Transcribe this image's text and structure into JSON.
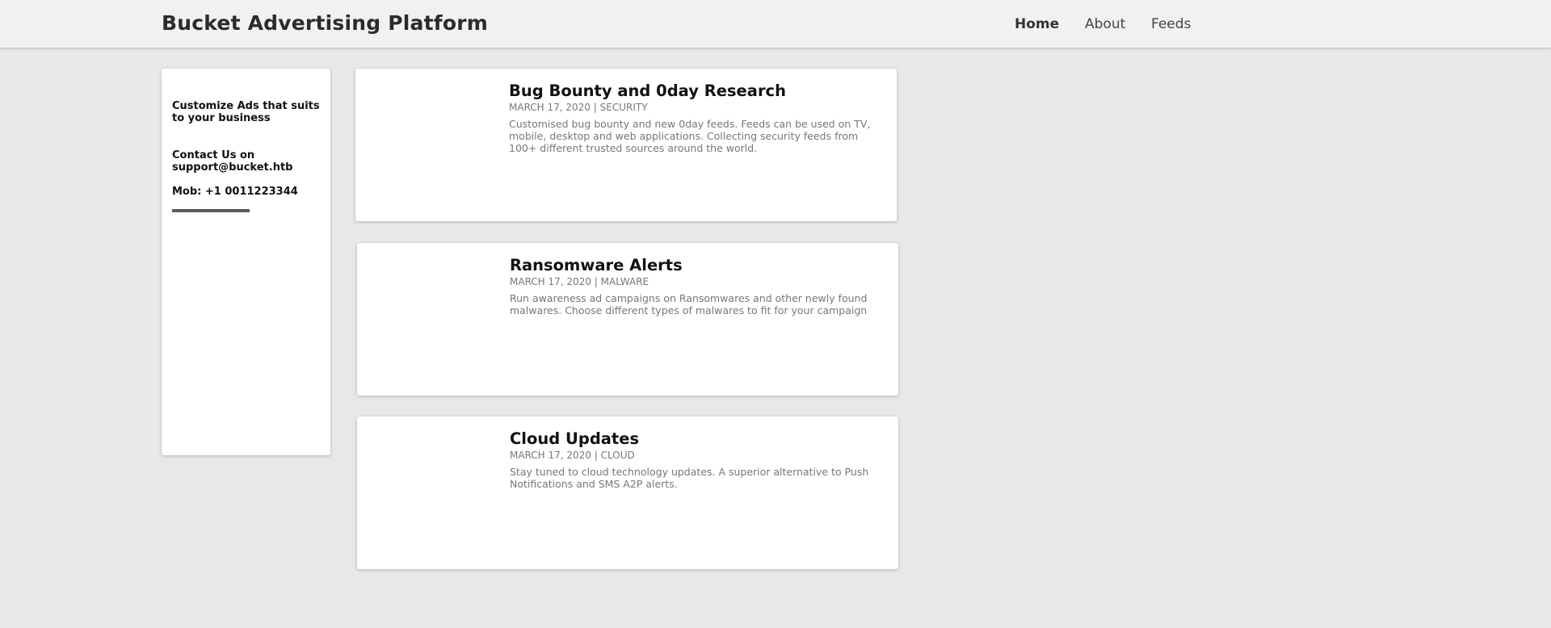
{
  "header": {
    "brand": "Bucket Advertising Platform",
    "nav": [
      {
        "label": "Home",
        "active": true
      },
      {
        "label": "About",
        "active": false
      },
      {
        "label": "Feeds",
        "active": false
      }
    ]
  },
  "sidebar": {
    "tagline": "Customize Ads that suits to your business",
    "contact": "Contact Us on support@bucket.htb",
    "mobile": "Mob: +1 0011223344"
  },
  "posts": [
    {
      "title": "Bug Bounty and 0day Research",
      "meta": "MARCH 17, 2020 | SECURITY",
      "description": "Customised bug bounty and new 0day feeds. Feeds can be used on TV, mobile, desktop and web applications. Collecting security feeds from 100+ different trusted sources around the world."
    },
    {
      "title": "Ransomware Alerts",
      "meta": "MARCH 17, 2020 | MALWARE",
      "description": "Run awareness ad campaigns on Ransomwares and other newly found malwares. Choose different types of malwares to fit for your campaign"
    },
    {
      "title": "Cloud Updates",
      "meta": "MARCH 17, 2020 | CLOUD",
      "description": "Stay tuned to cloud technology updates. A superior alternative to Push Notifications and SMS A2P alerts."
    }
  ]
}
